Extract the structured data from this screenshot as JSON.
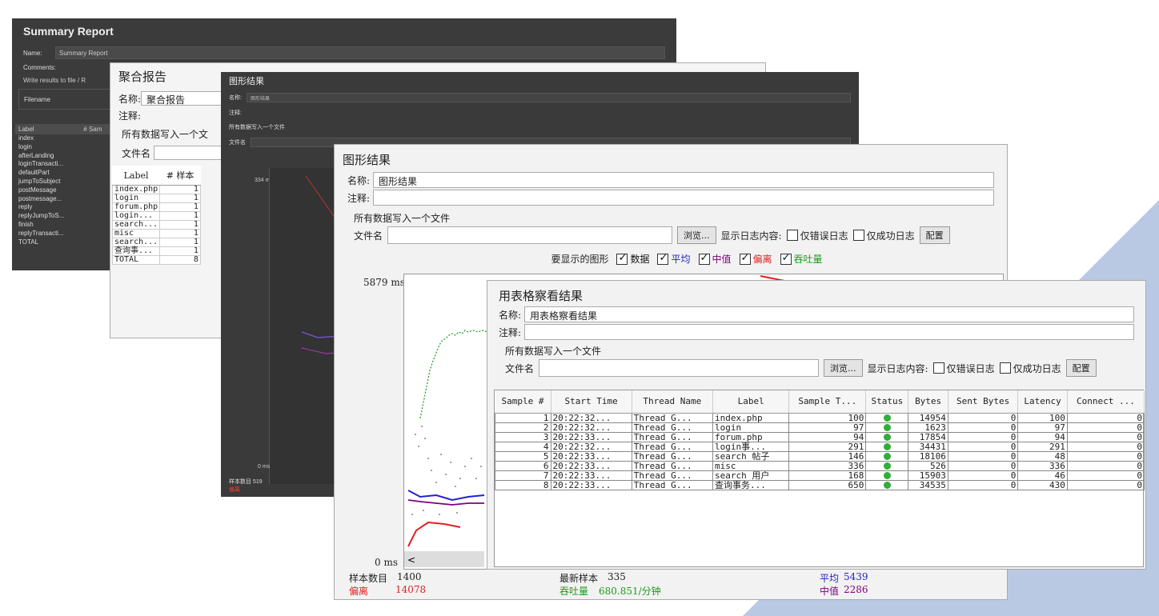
{
  "summary": {
    "title": "Summary Report",
    "name_label": "Name:",
    "name_value": "Summary Report",
    "comments_label": "Comments:",
    "write_label": "Write results to file / R",
    "filename_label": "Filename",
    "col_label": "Label",
    "col_samples": "# Sam",
    "rows": [
      "index",
      "login",
      "afterLanding",
      "loginTransacti...",
      "defaultPart",
      "jumpToSubject",
      "postMessage",
      "postmessage...",
      "reply",
      "replyJumpToS...",
      "finish",
      "replyTransacti...",
      "TOTAL"
    ]
  },
  "aggregate": {
    "title": "聚合报告",
    "name_label": "名称:",
    "name_value": "聚合报告",
    "comment_label": "注释:",
    "write_label": "所有数据写入一个文",
    "file_label": "文件名",
    "col_label": "Label",
    "col_samples": "# 样本",
    "rows": [
      {
        "label": "index.php",
        "n": "1"
      },
      {
        "label": "login",
        "n": "1"
      },
      {
        "label": "forum.php",
        "n": "1"
      },
      {
        "label": "login...",
        "n": "1"
      },
      {
        "label": "search...",
        "n": "1"
      },
      {
        "label": "misc",
        "n": "1"
      },
      {
        "label": "search...",
        "n": "1"
      },
      {
        "label": "查询事...",
        "n": "1"
      },
      {
        "label": "TOTAL",
        "n": "8"
      }
    ]
  },
  "graph_dark": {
    "title": "图形结果",
    "name_label": "名称:",
    "name_value": "图形结果",
    "comment_label": "注释:",
    "write_label": "所有数据写入一个文件",
    "file_label": "文件名",
    "y_top": "334 ms",
    "y_bottom": "0 ms",
    "samples_label": "样本数目",
    "samples_value": "519",
    "deviation_label": "偏离"
  },
  "graph": {
    "title": "图形结果",
    "name_label": "名称:",
    "name_value": "图形结果",
    "comment_label": "注释:",
    "write_label": "所有数据写入一个文件",
    "file_label": "文件名",
    "browse": "浏览...",
    "log_label": "显示日志内容:",
    "errors_only": "仅错误日志",
    "success_only": "仅成功日志",
    "config": "配置",
    "show_label": "要显示的图形",
    "legend": [
      {
        "label": "数据",
        "color": "#111111"
      },
      {
        "label": "平均",
        "color": "#2222cc"
      },
      {
        "label": "中值",
        "color": "#800080"
      },
      {
        "label": "偏离",
        "color": "#e02020"
      },
      {
        "label": "吞吐量",
        "color": "#1a9a1a"
      }
    ],
    "y_top": "5879 ms",
    "y_bottom": "0 ms",
    "scroll_left": "<",
    "samples_label": "样本数目",
    "samples_value": "1400",
    "deviation_label": "偏离",
    "deviation_value": "14078",
    "latest_label": "最新样本",
    "latest_value": "335",
    "throughput_label": "吞吐量",
    "throughput_value": "680.851/分钟",
    "average_label": "平均",
    "average_value": "5439",
    "median_label": "中值",
    "median_value": "2286"
  },
  "table_view": {
    "title": "用表格察看结果",
    "name_label": "名称:",
    "name_value": "用表格察看结果",
    "comment_label": "注释:",
    "write_label": "所有数据写入一个文件",
    "file_label": "文件名",
    "browse": "浏览...",
    "log_label": "显示日志内容:",
    "errors_only": "仅错误日志",
    "success_only": "仅成功日志",
    "config": "配置",
    "columns": [
      "Sample #",
      "Start Time",
      "Thread Name",
      "Label",
      "Sample T...",
      "Status",
      "Bytes",
      "Sent Bytes",
      "Latency",
      "Connect ..."
    ],
    "rows": [
      {
        "n": "1",
        "start": "20:22:32...",
        "thread": "Thread G...",
        "label": "index.php",
        "time": "100",
        "bytes": "14954",
        "sent": "0",
        "latency": "100",
        "connect": "0"
      },
      {
        "n": "2",
        "start": "20:22:32...",
        "thread": "Thread G...",
        "label": "login",
        "time": "97",
        "bytes": "1623",
        "sent": "0",
        "latency": "97",
        "connect": "0"
      },
      {
        "n": "3",
        "start": "20:22:33...",
        "thread": "Thread G...",
        "label": "forum.php",
        "time": "94",
        "bytes": "17854",
        "sent": "0",
        "latency": "94",
        "connect": "0"
      },
      {
        "n": "4",
        "start": "20:22:32...",
        "thread": "Thread G...",
        "label": "login事...",
        "time": "291",
        "bytes": "34431",
        "sent": "0",
        "latency": "291",
        "connect": "0"
      },
      {
        "n": "5",
        "start": "20:22:33...",
        "thread": "Thread G...",
        "label": "search 帖子",
        "time": "146",
        "bytes": "18106",
        "sent": "0",
        "latency": "48",
        "connect": "0"
      },
      {
        "n": "6",
        "start": "20:22:33...",
        "thread": "Thread G...",
        "label": "misc",
        "time": "336",
        "bytes": "526",
        "sent": "0",
        "latency": "336",
        "connect": "0"
      },
      {
        "n": "7",
        "start": "20:22:33...",
        "thread": "Thread G...",
        "label": "search 用户",
        "time": "168",
        "bytes": "15903",
        "sent": "0",
        "latency": "46",
        "connect": "0"
      },
      {
        "n": "8",
        "start": "20:22:33...",
        "thread": "Thread G...",
        "label": "查询事务...",
        "time": "650",
        "bytes": "34535",
        "sent": "0",
        "latency": "430",
        "connect": "0"
      }
    ]
  }
}
